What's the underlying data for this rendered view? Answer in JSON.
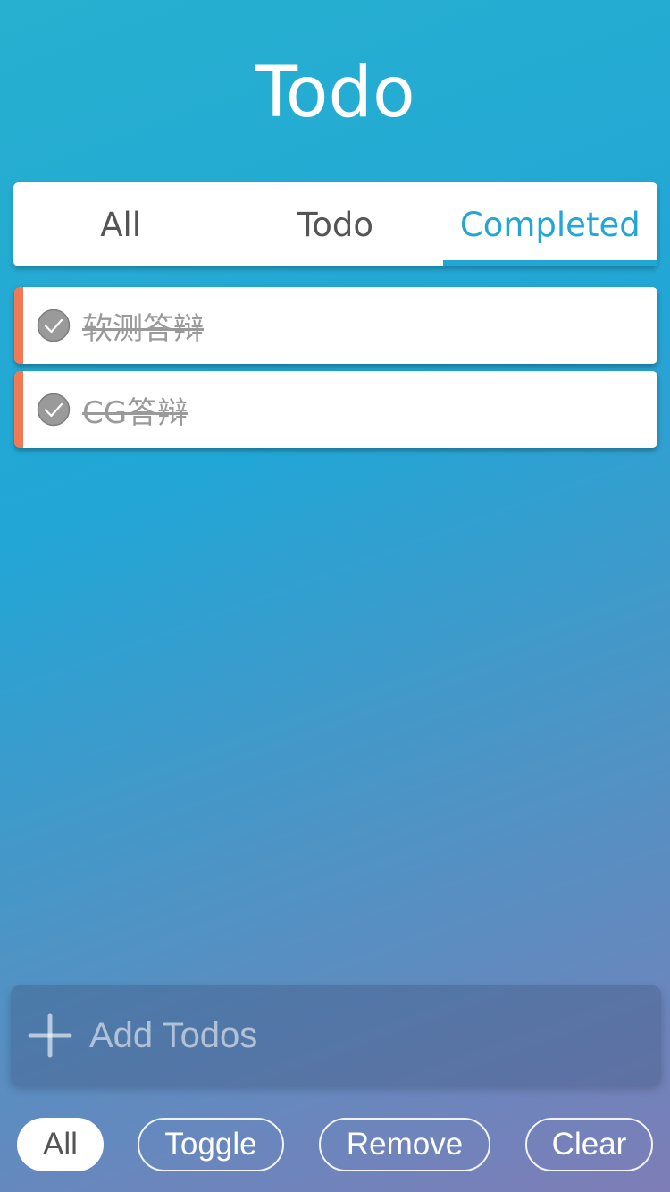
{
  "app": {
    "title": "Todo"
  },
  "tabs": [
    {
      "label": "All",
      "active": false
    },
    {
      "label": "Todo",
      "active": false
    },
    {
      "label": "Completed",
      "active": true
    }
  ],
  "todos": [
    {
      "text": "软测答辩",
      "completed": true,
      "icon": "check-circle-icon"
    },
    {
      "text": "CG答辩",
      "completed": true,
      "icon": "check-circle-icon"
    }
  ],
  "add": {
    "placeholder": "Add Todos",
    "value": "",
    "icon": "plus-icon"
  },
  "footer": {
    "buttons": [
      {
        "label": "All",
        "active": true
      },
      {
        "label": "Toggle",
        "active": false
      },
      {
        "label": "Remove",
        "active": false
      },
      {
        "label": "Clear",
        "active": false
      }
    ]
  },
  "colors": {
    "accent": "#22a6d6",
    "item_marker": "#ef7a55",
    "completed_text": "#9a9a9a"
  }
}
